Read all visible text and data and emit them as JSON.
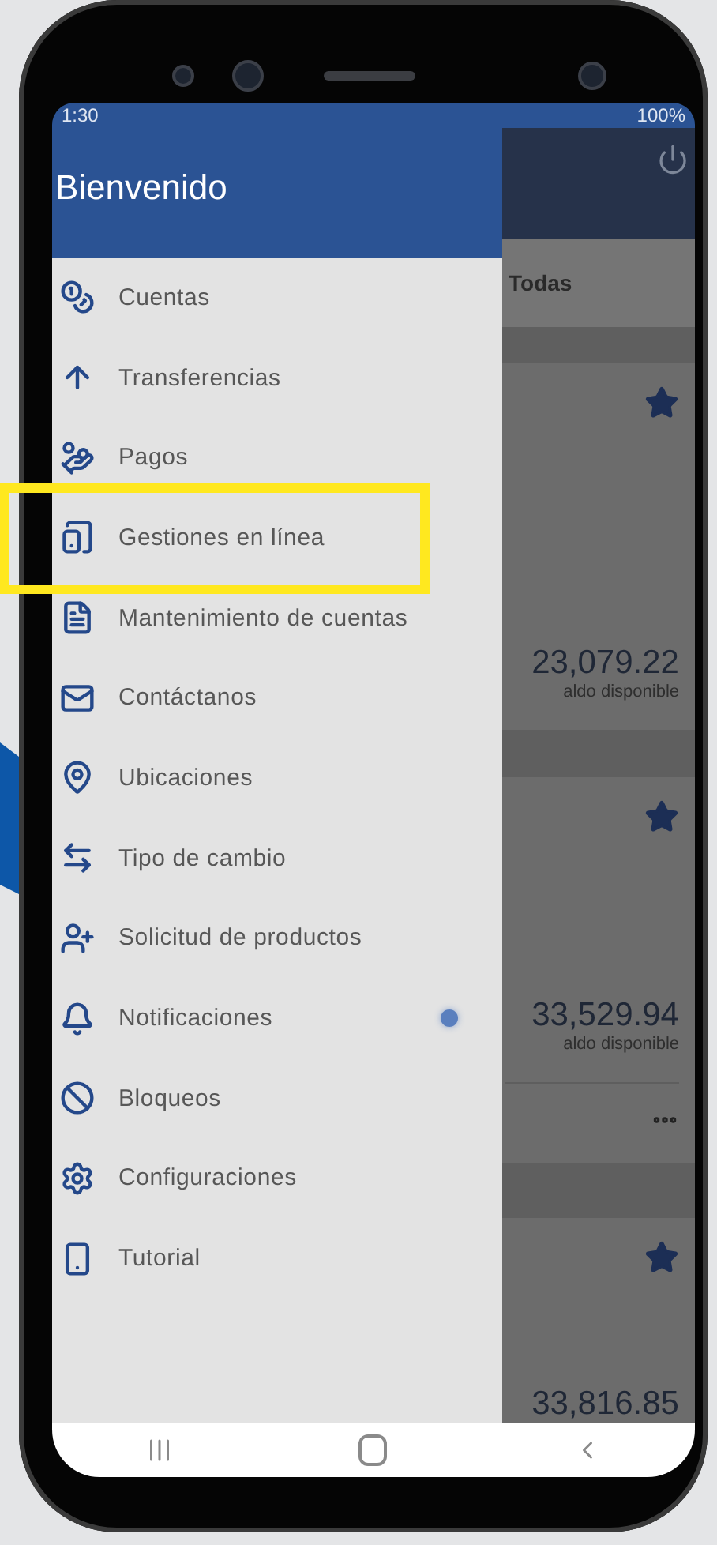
{
  "status_bar": {
    "time": "1:30",
    "battery": "100%"
  },
  "drawer": {
    "title": "Bienvenido",
    "items": [
      {
        "label": "Cuentas",
        "highlighted": false,
        "badge": false
      },
      {
        "label": "Transferencias",
        "highlighted": false,
        "badge": false
      },
      {
        "label": "Pagos",
        "highlighted": false,
        "badge": false
      },
      {
        "label": "Gestiones en línea",
        "highlighted": true,
        "badge": false
      },
      {
        "label": "Mantenimiento de cuentas",
        "highlighted": false,
        "badge": false
      },
      {
        "label": "Contáctanos",
        "highlighted": false,
        "badge": false
      },
      {
        "label": "Ubicaciones",
        "highlighted": false,
        "badge": false
      },
      {
        "label": "Tipo de cambio",
        "highlighted": false,
        "badge": false
      },
      {
        "label": "Solicitud de productos",
        "highlighted": false,
        "badge": false
      },
      {
        "label": "Notificaciones",
        "highlighted": false,
        "badge": true
      },
      {
        "label": "Bloqueos",
        "highlighted": false,
        "badge": false
      },
      {
        "label": "Configuraciones",
        "highlighted": false,
        "badge": false
      },
      {
        "label": "Tutorial",
        "highlighted": false,
        "badge": false
      }
    ]
  },
  "background_screen": {
    "tab": "Todas",
    "accounts": [
      {
        "amount": "23,079.22",
        "caption": "aldo disponible",
        "menu": false
      },
      {
        "amount": "33,529.94",
        "caption": "aldo disponible",
        "menu": true
      },
      {
        "amount": "33,816.85",
        "menu": false
      }
    ]
  }
}
